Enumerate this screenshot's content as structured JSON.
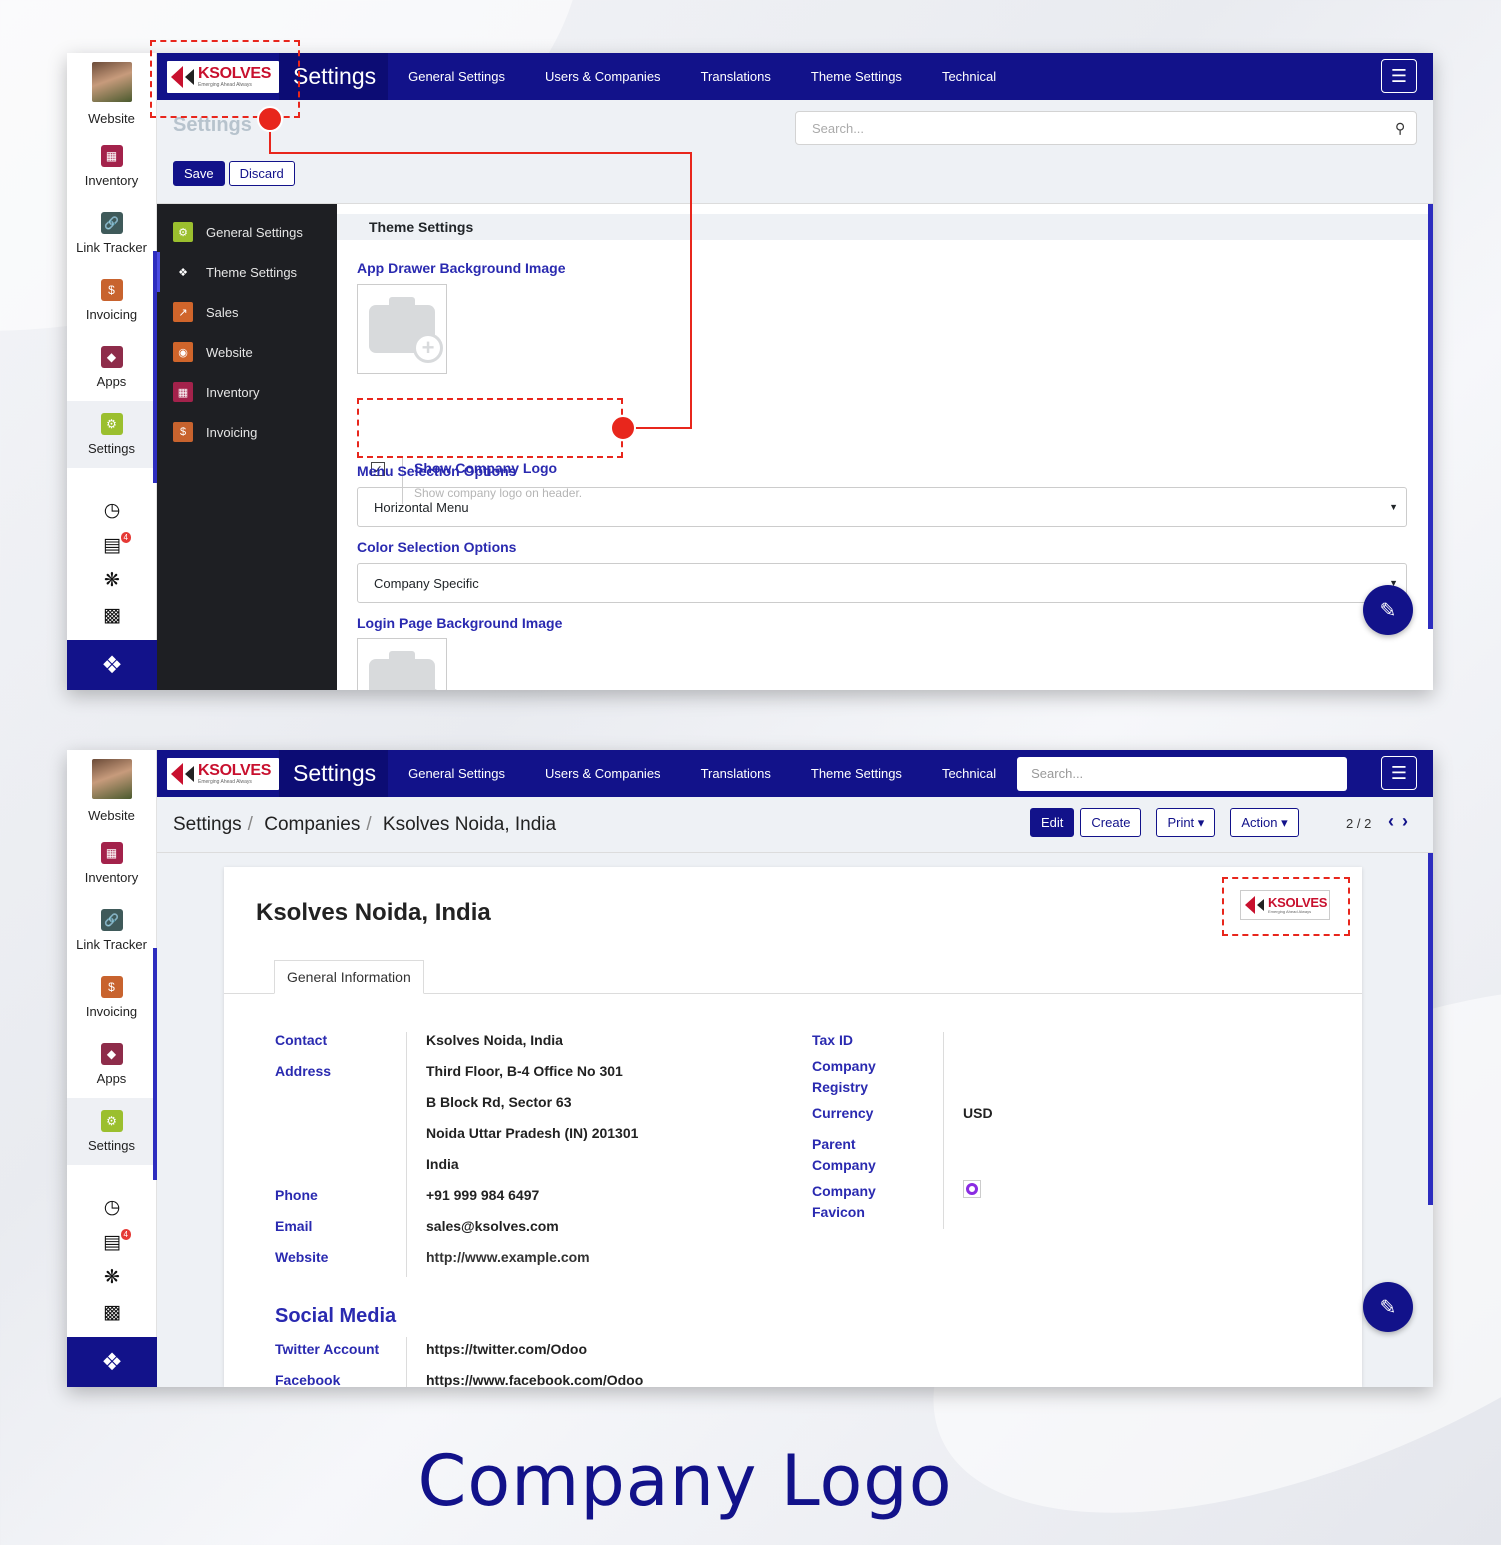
{
  "caption": "Company Logo",
  "logo": {
    "brand": "KSOLVES",
    "tagline": "Emerging Ahead Always"
  },
  "topbar": {
    "title": "Settings",
    "nav": [
      "General Settings",
      "Users & Companies",
      "Translations",
      "Theme Settings",
      "Technical"
    ],
    "search_placeholder": "Search..."
  },
  "rail": {
    "items": [
      "Website",
      "Inventory",
      "Link Tracker",
      "Invoicing",
      "Apps",
      "Settings"
    ],
    "active": "Settings",
    "chat_badge": "4",
    "tools": [
      "clock-icon",
      "chat-icon",
      "bug-icon",
      "building-icon"
    ]
  },
  "settings_view": {
    "control_title": "Settings",
    "save_label": "Save",
    "discard_label": "Discard",
    "search_placeholder": "Search...",
    "sidebar": [
      "General Settings",
      "Theme Settings",
      "Sales",
      "Website",
      "Inventory",
      "Invoicing"
    ],
    "sidebar_active": "Theme Settings",
    "section_title": "Theme Settings",
    "app_drawer_label": "App Drawer Background Image",
    "show_logo_label": "Show Company Logo",
    "show_logo_help": "Show company logo on header.",
    "show_logo_checked": true,
    "menu_selection_label": "Menu Selection Options",
    "menu_selection_value": "Horizontal Menu",
    "color_selection_label": "Color Selection Options",
    "color_selection_value": "Company Specific",
    "login_bg_label": "Login Page Background Image"
  },
  "company_view": {
    "breadcrumb": [
      "Settings",
      "Companies",
      "Ksolves Noida, India"
    ],
    "buttons": {
      "edit": "Edit",
      "create": "Create",
      "print": "Print",
      "action": "Action"
    },
    "pager": "2 / 2",
    "record_name": "Ksolves Noida, India",
    "tab": "General Information",
    "left_fields": {
      "contact_label": "Contact",
      "contact_value": "Ksolves Noida, India",
      "address_label": "Address",
      "address_lines": [
        "Third Floor, B-4 Office No 301",
        "B Block Rd, Sector 63",
        "Noida  Uttar Pradesh (IN)  201301",
        "India"
      ],
      "phone_label": "Phone",
      "phone_value": "+91 999 984 6497",
      "email_label": "Email",
      "email_value": "sales@ksolves.com",
      "website_label": "Website",
      "website_value": "http://www.example.com"
    },
    "right_fields": {
      "tax_id_label": "Tax ID",
      "registry_label_1": "Company",
      "registry_label_2": "Registry",
      "currency_label": "Currency",
      "currency_value": "USD",
      "parent_label_1": "Parent",
      "parent_label_2": "Company",
      "favicon_label_1": "Company",
      "favicon_label_2": "Favicon"
    },
    "social_media": {
      "title": "Social Media",
      "twitter_label": "Twitter Account",
      "twitter_value": "https://twitter.com/Odoo",
      "facebook_label": "Facebook",
      "facebook_value": "https://www.facebook.com/Odoo"
    }
  },
  "colors": {
    "primary": "#12128a",
    "annotation": "#e8261c",
    "label": "#2a2ab0"
  }
}
